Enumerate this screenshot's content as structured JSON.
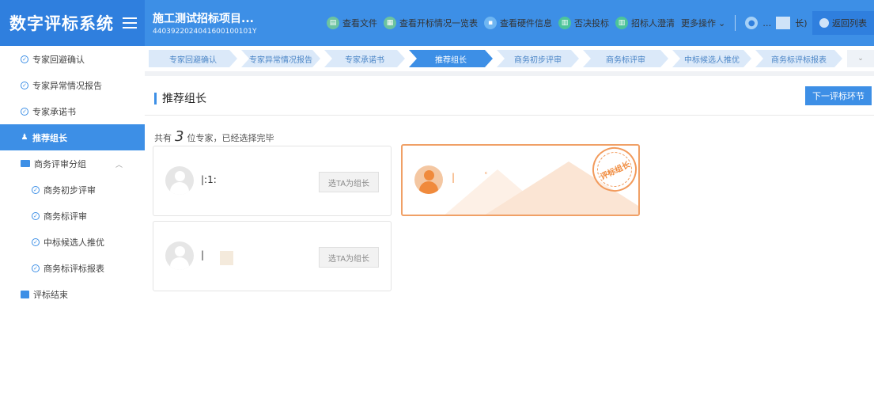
{
  "app": {
    "title": "数字评标系统"
  },
  "project": {
    "name": "施工测试招标项目...",
    "code": "440392202404160010010​1Y"
  },
  "header": {
    "actions": [
      {
        "label": "查看文件",
        "icon": "document-icon"
      },
      {
        "label": "查看开标情况一览表",
        "icon": "table-icon"
      },
      {
        "label": "查看硬件信息",
        "icon": "grid-icon"
      },
      {
        "label": "否决投标",
        "icon": "veto-icon"
      },
      {
        "label": "招标人澄清",
        "icon": "clarify-icon"
      }
    ],
    "more_label": "更多操作",
    "user_name": "长)",
    "return_label": "返回列表"
  },
  "sidebar": {
    "items": [
      {
        "label": "专家回避确认"
      },
      {
        "label": "专家异常情况报告"
      },
      {
        "label": "专家承诺书"
      },
      {
        "label": "推荐组长"
      },
      {
        "label": "商务评审分组"
      },
      {
        "label": "商务初步评审"
      },
      {
        "label": "商务标评审"
      },
      {
        "label": "中标候选人推优"
      },
      {
        "label": "商务标评标报表"
      },
      {
        "label": "评标结束"
      }
    ]
  },
  "steps": [
    {
      "label": "专家回避确认"
    },
    {
      "label": "专家异常情况报告"
    },
    {
      "label": "专家承诺书"
    },
    {
      "label": "推荐组长"
    },
    {
      "label": "商务初步评审"
    },
    {
      "label": "商务标评审"
    },
    {
      "label": "中标候选人推优"
    },
    {
      "label": "商务标评标报表"
    }
  ],
  "main": {
    "title": "推荐组长",
    "next_label": "下一评标环节",
    "summary_prefix": "共有",
    "summary_count": "3",
    "summary_suffix": "位专家，已经选择完毕",
    "experts": [
      {
        "name": "|:1:",
        "button": "选TA为组长"
      },
      {
        "name": "|",
        "button": "选TA为组长"
      },
      {
        "name": "|",
        "stamp": "评标组长"
      }
    ]
  }
}
